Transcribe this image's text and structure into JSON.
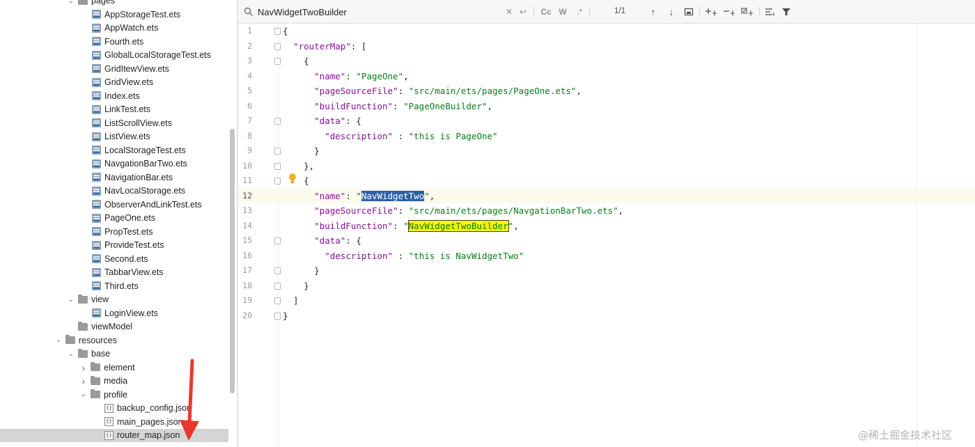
{
  "tree": {
    "items": [
      {
        "label": "pages",
        "type": "folder",
        "indent": 1,
        "expanded": true
      },
      {
        "label": "AppStorageTest.ets",
        "type": "ets",
        "indent": 2
      },
      {
        "label": "AppWatch.ets",
        "type": "ets",
        "indent": 2
      },
      {
        "label": "Fourth.ets",
        "type": "ets",
        "indent": 2
      },
      {
        "label": "GlobalLocalStorageTest.ets",
        "type": "ets",
        "indent": 2
      },
      {
        "label": "GridItewView.ets",
        "type": "ets",
        "indent": 2
      },
      {
        "label": "GridView.ets",
        "type": "ets",
        "indent": 2
      },
      {
        "label": "Index.ets",
        "type": "ets",
        "indent": 2
      },
      {
        "label": "LinkTest.ets",
        "type": "ets",
        "indent": 2
      },
      {
        "label": "ListScrollView.ets",
        "type": "ets",
        "indent": 2
      },
      {
        "label": "ListView.ets",
        "type": "ets",
        "indent": 2
      },
      {
        "label": "LocalStorageTest.ets",
        "type": "ets",
        "indent": 2
      },
      {
        "label": "NavgationBarTwo.ets",
        "type": "ets",
        "indent": 2
      },
      {
        "label": "NavigationBar.ets",
        "type": "ets",
        "indent": 2
      },
      {
        "label": "NavLocalStorage.ets",
        "type": "ets",
        "indent": 2
      },
      {
        "label": "ObserverAndLinkTest.ets",
        "type": "ets",
        "indent": 2
      },
      {
        "label": "PageOne.ets",
        "type": "ets",
        "indent": 2
      },
      {
        "label": "PropTest.ets",
        "type": "ets",
        "indent": 2
      },
      {
        "label": "ProvideTest.ets",
        "type": "ets",
        "indent": 2
      },
      {
        "label": "Second.ets",
        "type": "ets",
        "indent": 2
      },
      {
        "label": "TabbarView.ets",
        "type": "ets",
        "indent": 2
      },
      {
        "label": "Third.ets",
        "type": "ets",
        "indent": 2
      },
      {
        "label": "view",
        "type": "folder",
        "indent": 1,
        "expanded": true
      },
      {
        "label": "LoginView.ets",
        "type": "ets",
        "indent": 2
      },
      {
        "label": "viewModel",
        "type": "folder",
        "indent": 1,
        "expanded": null
      },
      {
        "label": "resources",
        "type": "folder",
        "indent": 0,
        "expanded": true
      },
      {
        "label": "base",
        "type": "folder",
        "indent": 1,
        "expanded": true
      },
      {
        "label": "element",
        "type": "folder",
        "indent": 2,
        "expanded": false
      },
      {
        "label": "media",
        "type": "folder",
        "indent": 2,
        "expanded": false
      },
      {
        "label": "profile",
        "type": "folder",
        "indent": 2,
        "expanded": true
      },
      {
        "label": "backup_config.json",
        "type": "json",
        "indent": 3
      },
      {
        "label": "main_pages.json",
        "type": "json",
        "indent": 3
      },
      {
        "label": "router_map.json",
        "type": "json",
        "indent": 3,
        "selected": true
      }
    ]
  },
  "search": {
    "query": "NavWidgetTwoBuilder",
    "count": "1/1",
    "case_label": "Cc",
    "word_label": "W",
    "regex_label": ".*"
  },
  "editor": {
    "current_line": 12,
    "lines": [
      {
        "n": "1",
        "html": "{"
      },
      {
        "n": "2",
        "html": "  <span class=\"key\">\"routerMap\"</span>: ["
      },
      {
        "n": "3",
        "html": "    {"
      },
      {
        "n": "4",
        "html": "      <span class=\"key\">\"name\"</span>: <span class=\"str\">\"PageOne\"</span>,"
      },
      {
        "n": "5",
        "html": "      <span class=\"key\">\"pageSourceFile\"</span>: <span class=\"str\">\"src/main/ets/pages/PageOne.ets\"</span>,"
      },
      {
        "n": "6",
        "html": "      <span class=\"key\">\"buildFunction\"</span>: <span class=\"str\">\"PageOneBuilder\"</span>,"
      },
      {
        "n": "7",
        "html": "      <span class=\"key\">\"data\"</span>: {"
      },
      {
        "n": "8",
        "html": "        <span class=\"key\">\"description\"</span> : <span class=\"str\">\"this is PageOne\"</span>"
      },
      {
        "n": "9",
        "html": "      }"
      },
      {
        "n": "10",
        "html": "    },"
      },
      {
        "n": "11",
        "html": "    {"
      },
      {
        "n": "12",
        "html": "      <span class=\"key\">\"name\"</span>: <span class=\"str\">\"<span class=\"sel\">NavWidgetTwo</span>\"</span>,"
      },
      {
        "n": "13",
        "html": "      <span class=\"key\">\"pageSourceFile\"</span>: <span class=\"str\">\"src/main/ets/pages/NavgationBarTwo.ets\"</span>,"
      },
      {
        "n": "14",
        "html": "      <span class=\"key\">\"buildFunction\"</span>: <span class=\"str\">\"<span class=\"hit\">NavWidgetTwoBuilder</span>\"</span>,"
      },
      {
        "n": "15",
        "html": "      <span class=\"key\">\"data\"</span>: {"
      },
      {
        "n": "16",
        "html": "        <span class=\"key\">\"description\"</span> : <span class=\"str\">\"this is NavWidgetTwo\"</span>"
      },
      {
        "n": "17",
        "html": "      }"
      },
      {
        "n": "18",
        "html": "    }"
      },
      {
        "n": "19",
        "html": "  ]"
      },
      {
        "n": "20",
        "html": "}"
      }
    ]
  },
  "watermark": "@稀土掘金技术社区",
  "colors": {
    "selection": "#2f5fa8",
    "search_hit": "#fbf500",
    "arrow": "#e8382d",
    "key": "#871094",
    "string": "#067d17"
  }
}
